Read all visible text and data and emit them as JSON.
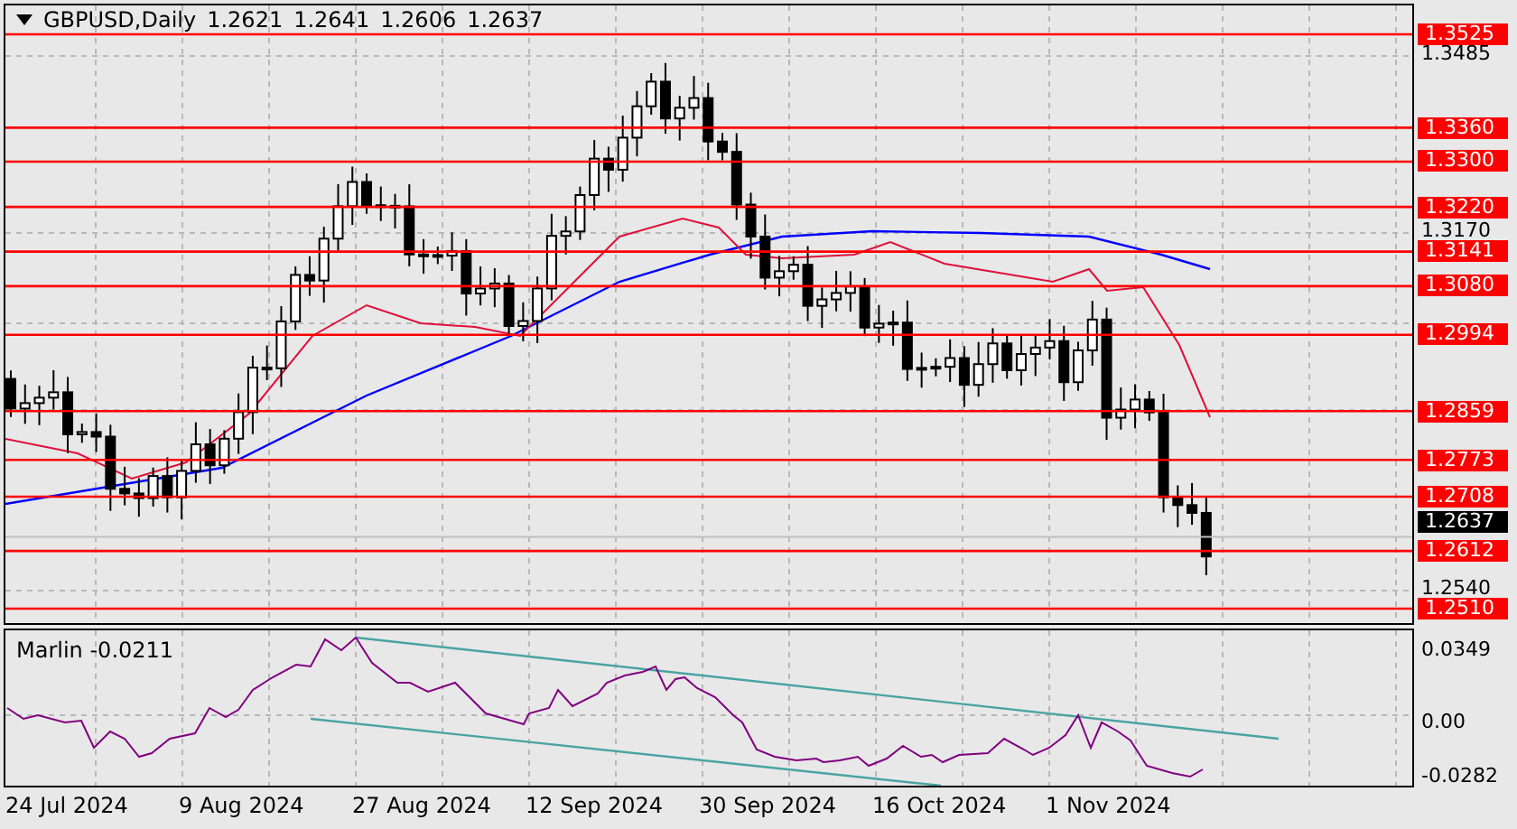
{
  "chart": {
    "symbol": "GBPUSD,Daily",
    "ohlc": [
      "1.2621",
      "1.2641",
      "1.2606",
      "1.2637"
    ],
    "levels": [
      {
        "label": "1.3525"
      },
      {
        "label": "1.3360"
      },
      {
        "label": "1.3300"
      },
      {
        "label": "1.3220"
      },
      {
        "label": "1.3141"
      },
      {
        "label": "1.3080"
      },
      {
        "label": "1.2994"
      },
      {
        "label": "1.2859"
      },
      {
        "label": "1.2773"
      },
      {
        "label": "1.2708"
      },
      {
        "label": "1.2612"
      },
      {
        "label": "1.2510"
      }
    ],
    "price_ticks": [
      "1.3485",
      "1.3170",
      "1.2540"
    ],
    "current_price": "1.2637"
  },
  "indicator": {
    "label": "Marlin -0.0211",
    "ticks": [
      "0.0349",
      "0.00",
      "-0.0282"
    ]
  },
  "dates": [
    "24 Jul 2024",
    "9 Aug 2024",
    "27 Aug 2024",
    "12 Sep 2024",
    "30 Sep 2024",
    "16 Oct 2024",
    "1 Nov 2024"
  ]
}
